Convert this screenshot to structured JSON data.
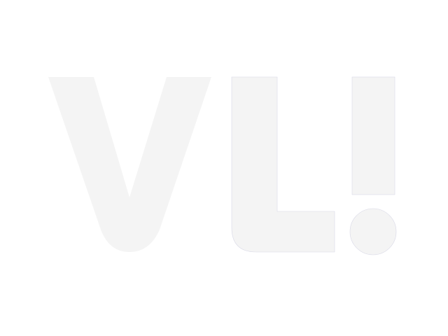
{
  "logo": {
    "text": "VL!",
    "letters": [
      "V",
      "L",
      "!"
    ]
  },
  "colors": {
    "background": "#ffffff",
    "glyph_fill": "#f4f4f4",
    "glyph_outline": "#d8d8e6"
  }
}
